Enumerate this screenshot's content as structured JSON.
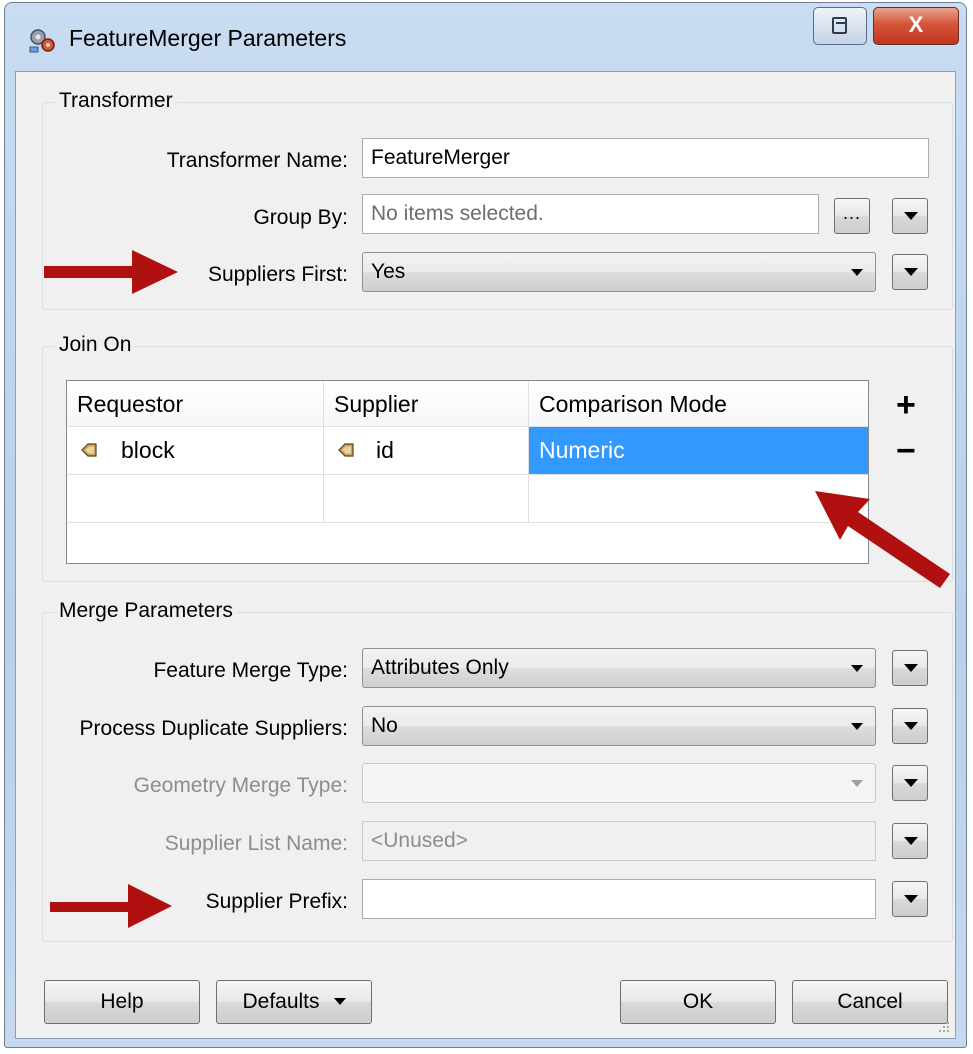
{
  "window": {
    "title": "FeatureMerger Parameters",
    "close_glyph": "X"
  },
  "transformer": {
    "legend": "Transformer",
    "name_label": "Transformer Name:",
    "name_value": "FeatureMerger",
    "group_by_label": "Group By:",
    "group_by_placeholder": "No items selected.",
    "group_by_browse": "...",
    "suppliers_first_label": "Suppliers First:",
    "suppliers_first_value": "Yes"
  },
  "join_on": {
    "legend": "Join On",
    "columns": [
      "Requestor",
      "Supplier",
      "Comparison Mode"
    ],
    "rows": [
      {
        "requestor": "block",
        "supplier": "id",
        "mode": "Numeric"
      }
    ],
    "add_glyph": "+",
    "remove_glyph": "−"
  },
  "merge": {
    "legend": "Merge Parameters",
    "feature_merge_type_label": "Feature Merge Type:",
    "feature_merge_type_value": "Attributes Only",
    "process_dup_label": "Process Duplicate Suppliers:",
    "process_dup_value": "No",
    "geometry_merge_type_label": "Geometry Merge Type:",
    "geometry_merge_type_value": "",
    "supplier_list_name_label": "Supplier List Name:",
    "supplier_list_name_value": "<Unused>",
    "supplier_prefix_label": "Supplier Prefix:",
    "supplier_prefix_value": ""
  },
  "buttons": {
    "help": "Help",
    "defaults": "Defaults",
    "ok": "OK",
    "cancel": "Cancel"
  },
  "colors": {
    "selection": "#3399ff",
    "annotation_arrow": "#b01010"
  }
}
